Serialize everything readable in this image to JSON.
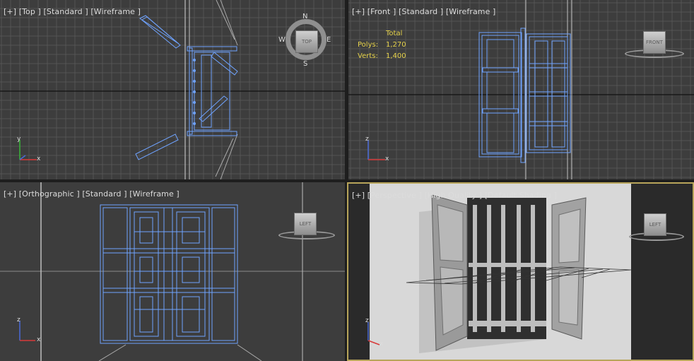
{
  "viewports": {
    "top": {
      "label": "[+] [Top ] [Standard ] [Wireframe ]",
      "viewcube": "TOP",
      "compass": {
        "n": "N",
        "s": "S",
        "e": "E",
        "w": "W"
      },
      "axes": {
        "x": "x",
        "y": "y"
      }
    },
    "front": {
      "label": "[+] [Front ] [Standard ] [Wireframe ]",
      "viewcube": "FRONT",
      "axes": {
        "x": "x",
        "z": "z"
      },
      "stats": {
        "header": "Total",
        "polys_label": "Polys:",
        "polys_value": "1,270",
        "verts_label": "Verts:",
        "verts_value": "1,400"
      }
    },
    "ortho": {
      "label": "[+] [Orthographic ] [Standard ] [Wireframe ]",
      "viewcube": "LEFT",
      "axes": {
        "x": "x",
        "z": "z"
      }
    },
    "perspective": {
      "label": "[+] [Perspective ] [High Quality ] [Default Shading ]",
      "viewcube": "LEFT",
      "axes": {
        "x": "x",
        "z": "z"
      }
    }
  },
  "colors": {
    "viewport_bg": "#3d3d3d",
    "grid": "#5a5a5a",
    "wire": "#6fa3ff",
    "stats": "#e6d24a",
    "active_border": "#b8a55a"
  }
}
